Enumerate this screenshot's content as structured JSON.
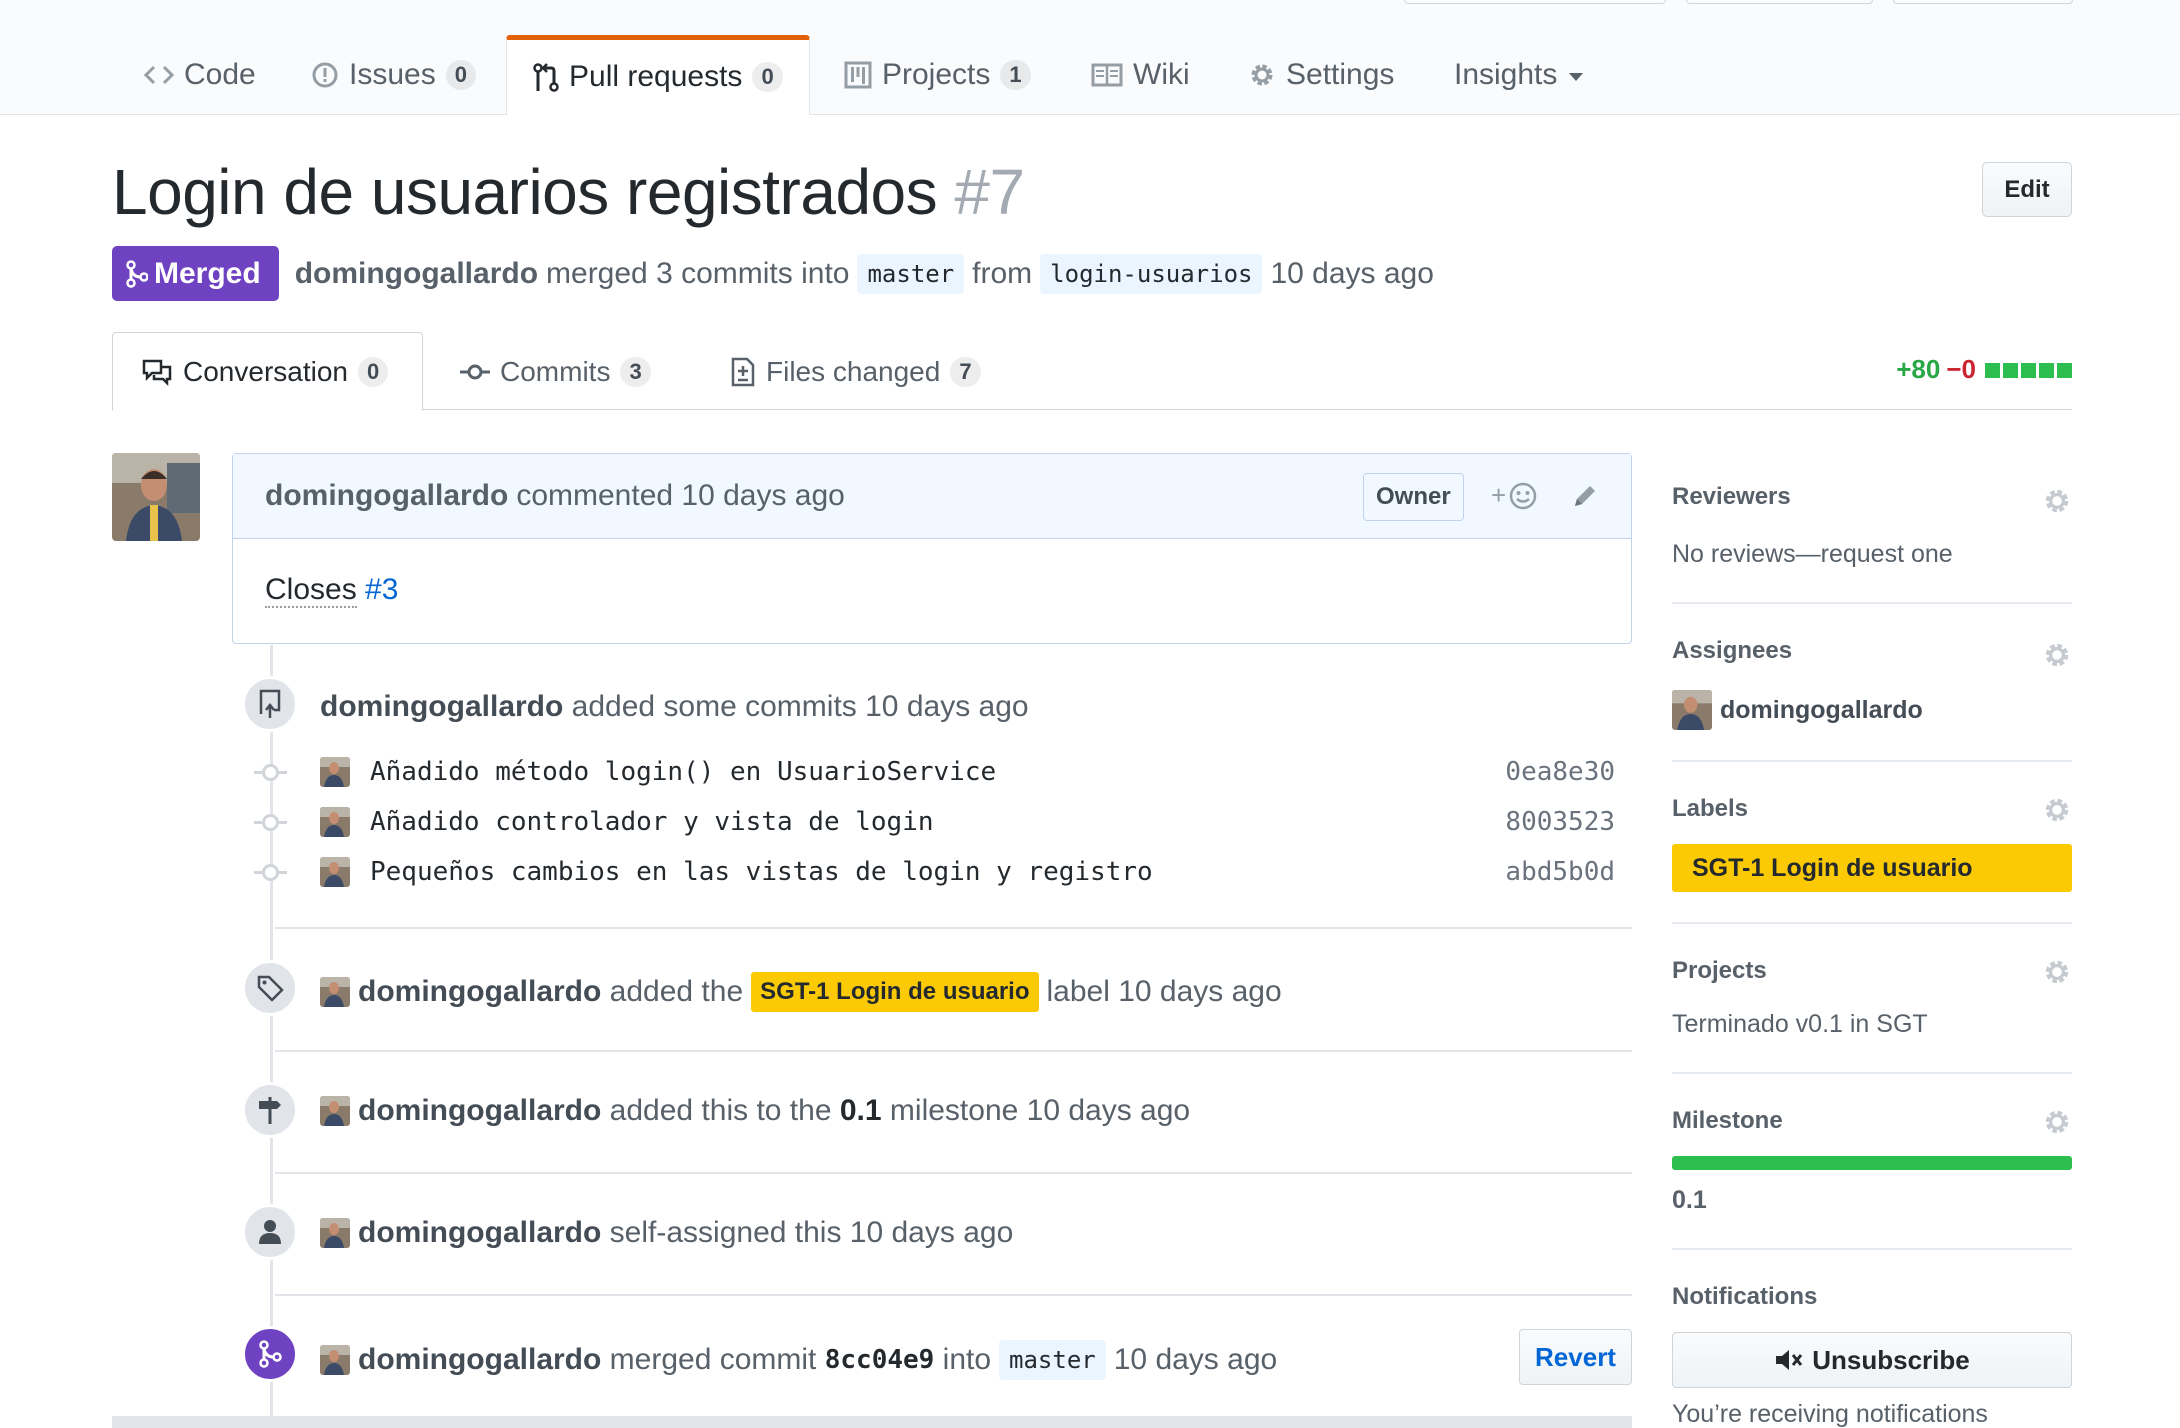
{
  "nav": {
    "items": [
      {
        "label": "Code",
        "count": null
      },
      {
        "label": "Issues",
        "count": "0"
      },
      {
        "label": "Pull requests",
        "count": "0"
      },
      {
        "label": "Projects",
        "count": "1"
      },
      {
        "label": "Wiki",
        "count": null
      },
      {
        "label": "Settings",
        "count": null
      },
      {
        "label": "Insights",
        "count": null
      }
    ],
    "selected": "Pull requests"
  },
  "pr": {
    "title": "Login de usuarios registrados",
    "number": "#7",
    "edit_label": "Edit",
    "state": "Merged",
    "author": "domingogallardo",
    "merge_text": "merged 3 commits into",
    "base_branch": "master",
    "from_text": "from",
    "head_branch": "login-usuarios",
    "time": "10 days ago"
  },
  "tabs": [
    {
      "label": "Conversation",
      "count": "0"
    },
    {
      "label": "Commits",
      "count": "3"
    },
    {
      "label": "Files changed",
      "count": "7"
    }
  ],
  "diffstat": {
    "additions": "+80",
    "deletions": "−0"
  },
  "comment": {
    "author": "domingogallardo",
    "action": "commented 10 days ago",
    "role": "Owner",
    "reaction_plus": "+",
    "body_text": "Closes",
    "body_link": "#3"
  },
  "timeline": {
    "commits_event": {
      "author": "domingogallardo",
      "text": "added some commits 10 days ago"
    },
    "commits": [
      {
        "message": "Añadido método login() en UsuarioService",
        "sha": "0ea8e30"
      },
      {
        "message": "Añadido controlador y vista de login",
        "sha": "8003523"
      },
      {
        "message": "Pequeños cambios en las vistas de login y registro",
        "sha": "abd5b0d"
      }
    ],
    "label_event": {
      "author": "domingogallardo",
      "pre": "added the",
      "label": "SGT-1 Login de usuario",
      "post": "label 10 days ago"
    },
    "milestone_event": {
      "author": "domingogallardo",
      "pre": "added this to the",
      "milestone": "0.1",
      "post": "milestone 10 days ago"
    },
    "assign_event": {
      "author": "domingogallardo",
      "text": "self-assigned this 10 days ago"
    },
    "merge_event": {
      "author": "domingogallardo",
      "pre": "merged commit",
      "sha": "8cc04e9",
      "mid": "into",
      "branch": "master",
      "post": "10 days ago",
      "revert_label": "Revert"
    }
  },
  "sidebar": {
    "reviewers": {
      "title": "Reviewers",
      "text": "No reviews—request one"
    },
    "assignees": {
      "title": "Assignees",
      "user": "domingogallardo"
    },
    "labels": {
      "title": "Labels",
      "label": "SGT-1 Login de usuario"
    },
    "projects": {
      "title": "Projects",
      "text": "Terminado v0.1 in SGT"
    },
    "milestone": {
      "title": "Milestone",
      "name": "0.1",
      "progress": 1.0
    },
    "notifications": {
      "title": "Notifications",
      "button": "Unsubscribe",
      "text": "You’re receiving notifications"
    }
  },
  "colors": {
    "merged": "#6f42c1",
    "label": "#fbca04",
    "link": "#0366d6",
    "additions": "#28a745",
    "deletions": "#cb2431",
    "tab_accent": "#e36209"
  }
}
